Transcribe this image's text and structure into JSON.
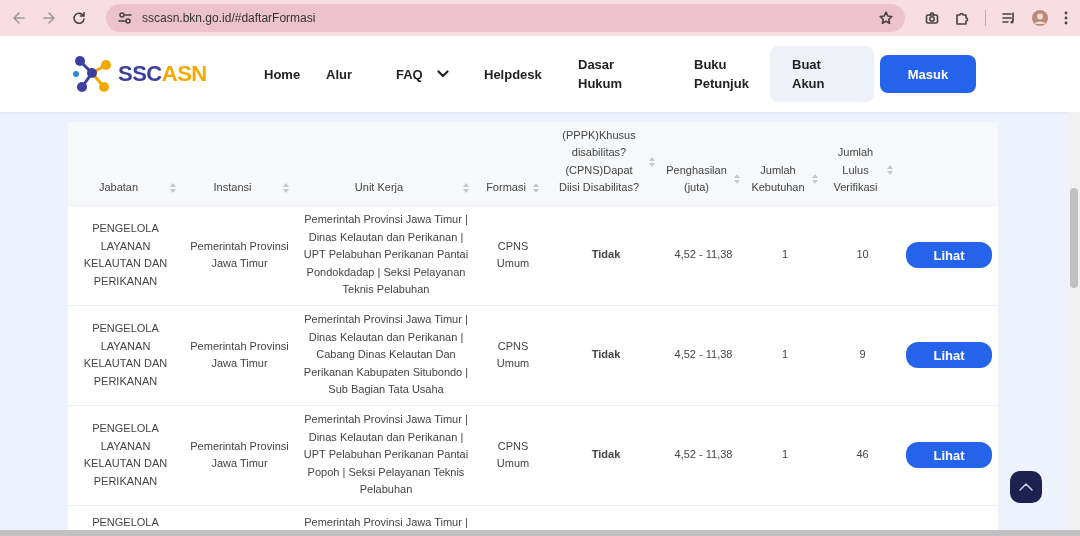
{
  "browser": {
    "url": "sscasn.bkn.go.id/#daftarFormasi"
  },
  "logo": {
    "part_1": "SSC",
    "part_2": "ASN"
  },
  "nav": [
    {
      "label": "Home",
      "kind": "link"
    },
    {
      "label": "Alur",
      "kind": "link"
    },
    {
      "label": "FAQ",
      "kind": "dropdown"
    },
    {
      "label": "Helpdesk",
      "kind": "link"
    },
    {
      "label": "Dasar Hukum",
      "kind": "link"
    },
    {
      "label": "Buku Petunjuk",
      "kind": "link"
    },
    {
      "label": "Buat Akun",
      "kind": "soft"
    },
    {
      "label": "Masuk",
      "kind": "primary"
    }
  ],
  "table": {
    "columns": [
      {
        "label": "Jabatan"
      },
      {
        "label": "Instansi"
      },
      {
        "label": "Unit Kerja"
      },
      {
        "label": "Formasi"
      },
      {
        "label": "(PPPK)Khusus disabilitas?(CPNS)Dapat Diisi Disabilitas?"
      },
      {
        "label": "Penghasilan (juta)"
      },
      {
        "label": "Jumlah Kebutuhan"
      },
      {
        "label": "Jumlah Lulus Verifikasi"
      }
    ],
    "rows": [
      {
        "cells": [
          "PENGELOLA LAYANAN KELAUTAN DAN PERIKANAN",
          "Pemerintah Provinsi Jawa Timur",
          "Pemerintah Provinsi Jawa Timur | Dinas Kelautan dan Perikanan | UPT Pelabuhan Perikanan Pantai Pondokdadap | Seksi Pelayanan Teknis Pelabuhan",
          "CPNS Umum",
          "Tidak",
          "4,52 - 11,38",
          "1",
          "10"
        ],
        "action": "Lihat"
      },
      {
        "cells": [
          "PENGELOLA LAYANAN KELAUTAN DAN PERIKANAN",
          "Pemerintah Provinsi Jawa Timur",
          "Pemerintah Provinsi Jawa Timur | Dinas Kelautan dan Perikanan | Cabang Dinas Kelautan Dan Perikanan Kabupaten Situbondo | Sub Bagian Tata Usaha",
          "CPNS Umum",
          "Tidak",
          "4,52 - 11,38",
          "1",
          "9"
        ],
        "action": "Lihat"
      },
      {
        "cells": [
          "PENGELOLA LAYANAN KELAUTAN DAN PERIKANAN",
          "Pemerintah Provinsi Jawa Timur",
          "Pemerintah Provinsi Jawa Timur | Dinas Kelautan dan Perikanan | UPT Pelabuhan Perikanan Pantai Popoh | Seksi Pelayanan Teknis Pelabuhan",
          "CPNS Umum",
          "Tidak",
          "4,52 - 11,38",
          "1",
          "46"
        ],
        "action": "Lihat"
      },
      {
        "cells": [
          "PENGELOLA",
          null,
          "Pemerintah Provinsi Jawa Timur |"
        ]
      }
    ]
  }
}
